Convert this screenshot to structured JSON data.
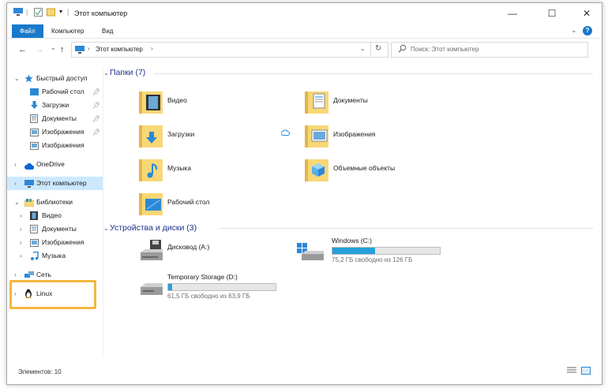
{
  "window": {
    "title": "Этот компьютер",
    "controls": {
      "minimize": "—",
      "maximize": "☐",
      "close": "✕"
    }
  },
  "ribbon": {
    "tabs": [
      "Файл",
      "Компьютер",
      "Вид"
    ],
    "help": "?"
  },
  "nav": {
    "back": "←",
    "forward": "→",
    "recent": "⌄",
    "up": "↑",
    "address_label": "Этот компьютер",
    "refresh": "↻",
    "search_placeholder": "Поиск: Этот компьютер"
  },
  "sidebar": {
    "quick_access": "Быстрый доступ",
    "quick_items": [
      "Рабочий стол",
      "Загрузки",
      "Документы",
      "Изображения",
      "Изображения"
    ],
    "onedrive": "OneDrive",
    "this_pc": "Этот компьютер",
    "libraries": "Библиотеки",
    "library_items": [
      "Видео",
      "Документы",
      "Изображения",
      "Музыка"
    ],
    "network": "Сеть",
    "linux": "Linux"
  },
  "content": {
    "folders_header": "Папки (7)",
    "folders": [
      "Видео",
      "Документы",
      "Загрузки",
      "Изображения",
      "Музыка",
      "Объемные объекты",
      "Рабочий стол"
    ],
    "drives_header": "Устройства и диски (3)",
    "drives": [
      {
        "name": "Дисковод (A:)",
        "free": "",
        "used_fraction": null
      },
      {
        "name": "Windows (C:)",
        "free": "75,2 ГБ свободно из 126 ГБ",
        "used_fraction": 0.4
      },
      {
        "name": "Temporary Storage (D:)",
        "free": "61,5 ГБ свободно из 63,9 ГБ",
        "used_fraction": 0.04
      }
    ]
  },
  "status": {
    "items": "Элементов: 10"
  },
  "colors": {
    "accent": "#1979ca",
    "selected": "#cce8ff",
    "highlight": "#f4b73f",
    "bar_fill": "#26a0da",
    "folder": "#f8d775"
  }
}
